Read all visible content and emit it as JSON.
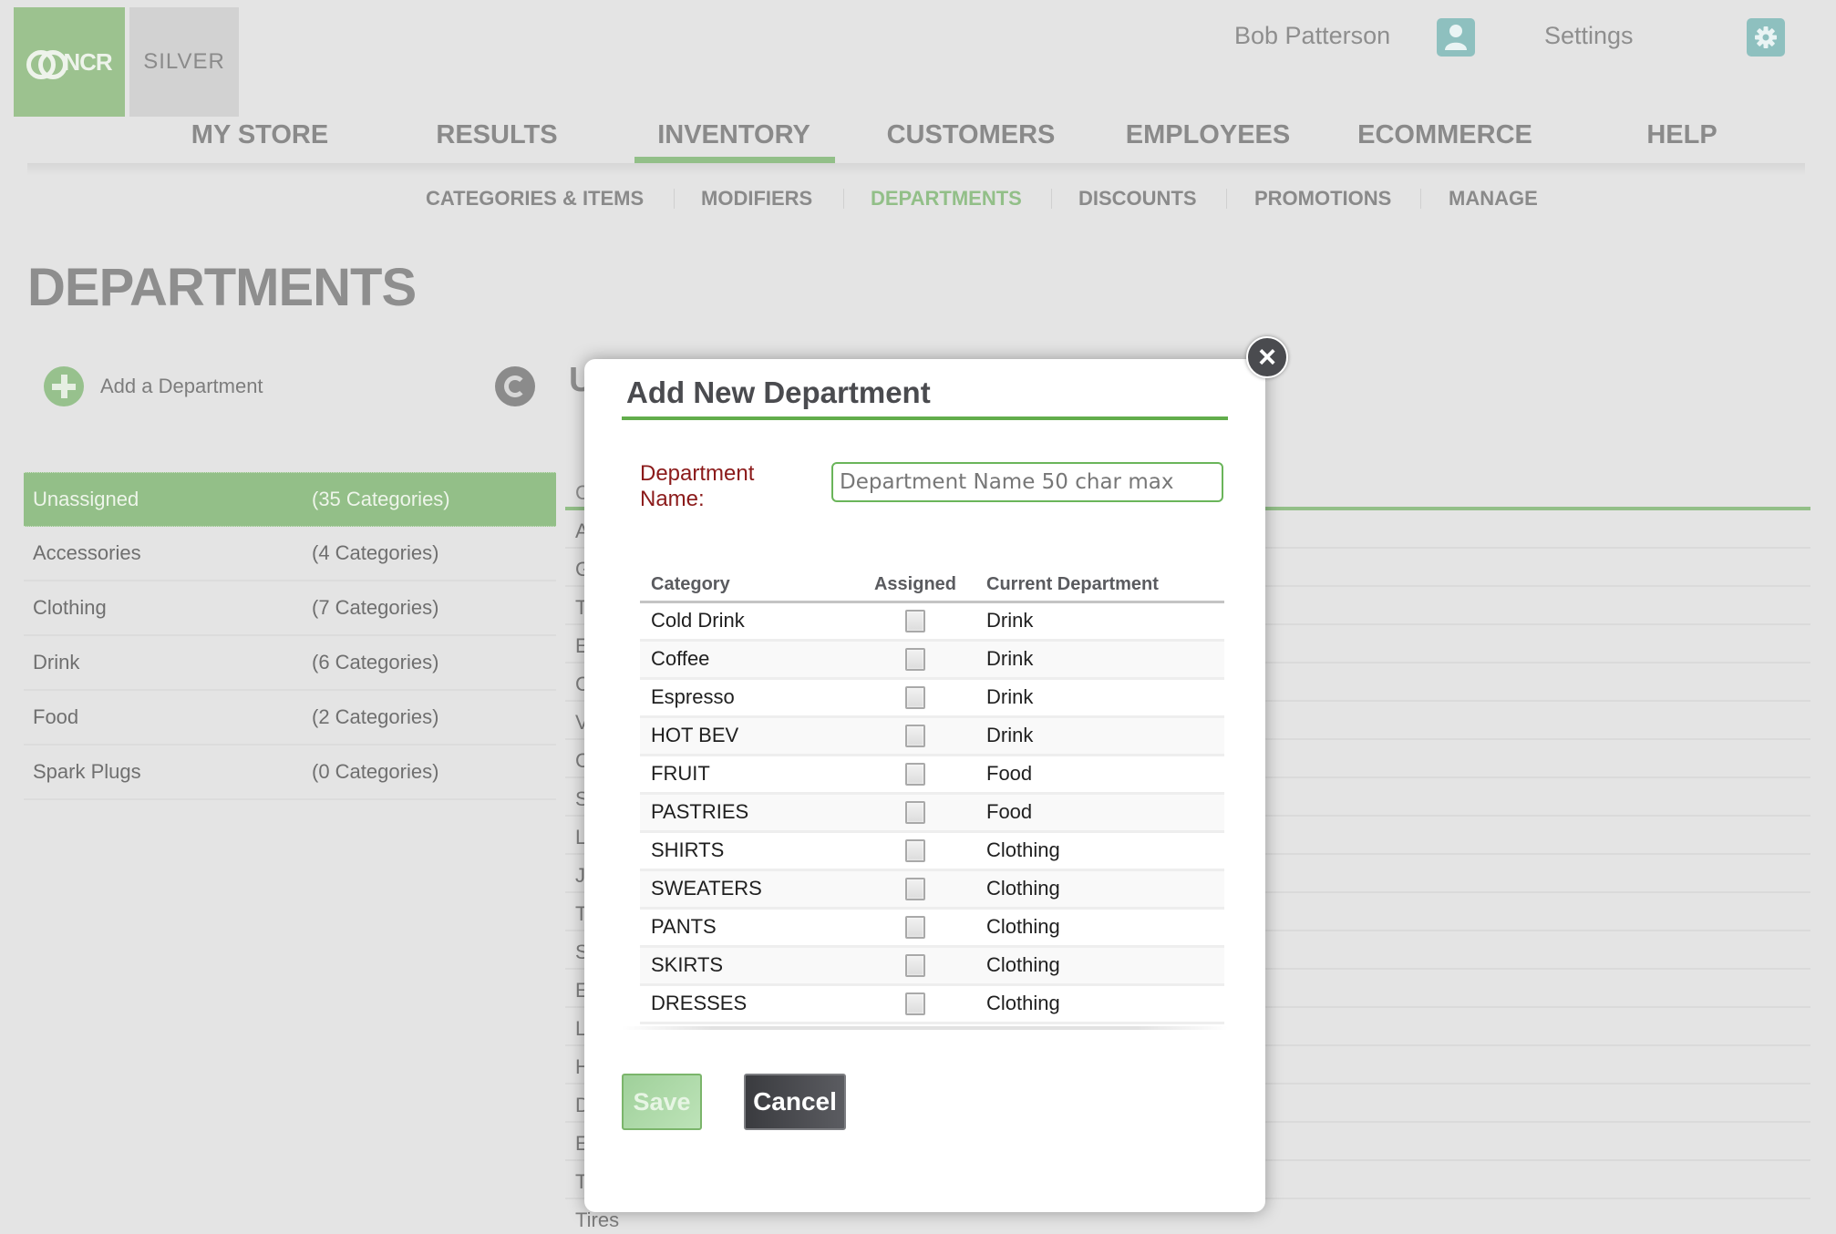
{
  "header": {
    "logo_primary": "NCR",
    "logo_secondary": "SILVER",
    "user_name": "Bob Patterson",
    "settings_label": "Settings"
  },
  "main_nav": {
    "items": [
      "MY STORE",
      "RESULTS",
      "INVENTORY",
      "CUSTOMERS",
      "EMPLOYEES",
      "ECOMMERCE",
      "HELP"
    ],
    "active": "INVENTORY"
  },
  "sub_nav": {
    "items": [
      "CATEGORIES & ITEMS",
      "MODIFIERS",
      "DEPARTMENTS",
      "DISCOUNTS",
      "PROMOTIONS",
      "MANAGE"
    ],
    "active": "DEPARTMENTS"
  },
  "page": {
    "title": "DEPARTMENTS",
    "add_department_label": "Add a Department",
    "background_heading_partial": "U",
    "departments": [
      {
        "name": "Unassigned",
        "count": "(35 Categories)",
        "selected": true
      },
      {
        "name": "Accessories",
        "count": "(4 Categories)"
      },
      {
        "name": "Clothing",
        "count": "(7 Categories)"
      },
      {
        "name": "Drink",
        "count": "(6 Categories)"
      },
      {
        "name": "Food",
        "count": "(2 Categories)"
      },
      {
        "name": "Spark Plugs",
        "count": "(0 Categories)"
      }
    ],
    "background_table": {
      "header_partial": "C",
      "rows_partial": [
        "A",
        "G",
        "T",
        "E",
        "C",
        "V",
        "C",
        "S",
        "L",
        "J",
        "T",
        "S",
        "E",
        "L",
        "H",
        "D",
        "E",
        "T",
        "Tires"
      ]
    }
  },
  "modal": {
    "title": "Add New Department",
    "field_label": "Department Name:",
    "name_input_value": "",
    "name_input_placeholder": "Department Name 50 char max",
    "table": {
      "headers": [
        "Category",
        "Assigned",
        "Current Department"
      ],
      "rows": [
        {
          "category": "Cold Drink",
          "assigned": false,
          "current_department": "Drink"
        },
        {
          "category": "Coffee",
          "assigned": false,
          "current_department": "Drink"
        },
        {
          "category": "Espresso",
          "assigned": false,
          "current_department": "Drink"
        },
        {
          "category": "HOT BEV",
          "assigned": false,
          "current_department": "Drink"
        },
        {
          "category": "FRUIT",
          "assigned": false,
          "current_department": "Food"
        },
        {
          "category": "PASTRIES",
          "assigned": false,
          "current_department": "Food"
        },
        {
          "category": "SHIRTS",
          "assigned": false,
          "current_department": "Clothing"
        },
        {
          "category": "SWEATERS",
          "assigned": false,
          "current_department": "Clothing"
        },
        {
          "category": "PANTS",
          "assigned": false,
          "current_department": "Clothing"
        },
        {
          "category": "SKIRTS",
          "assigned": false,
          "current_department": "Clothing"
        },
        {
          "category": "DRESSES",
          "assigned": false,
          "current_department": "Clothing"
        }
      ]
    },
    "save_label": "Save",
    "cancel_label": "Cancel",
    "close_icon": "×"
  },
  "colors": {
    "accent_green": "#92bf88",
    "title_line_green": "#62ad4c",
    "label_red": "#8b1a1a",
    "icon_teal": "#8ec0bf",
    "dark_button": "#4a4b4f"
  }
}
